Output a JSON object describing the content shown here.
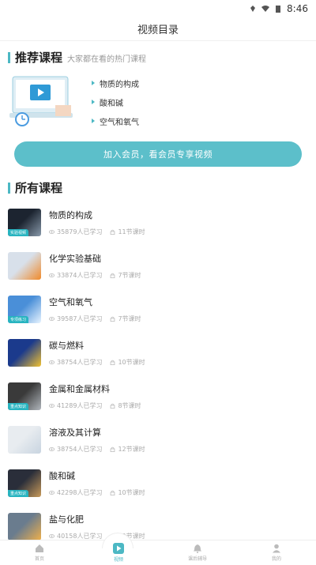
{
  "status": {
    "time": "8:46"
  },
  "page": {
    "title": "视频目录"
  },
  "recommend": {
    "title": "推荐课程",
    "subtitle": "大家都在看的热门课程",
    "items": [
      "物质的构成",
      "酸和碱",
      "空气和氧气"
    ]
  },
  "join_button": "加入会员，看会员专享视频",
  "all_courses": {
    "title": "所有课程",
    "items": [
      {
        "title": "物质的构成",
        "learners": "35879人已学习",
        "lessons": "11节课时",
        "tag": "实验视频",
        "colors": [
          "#1c2430",
          "#8899aa"
        ]
      },
      {
        "title": "化学实验基础",
        "learners": "33874人已学习",
        "lessons": "7节课时",
        "tag": "",
        "colors": [
          "#d8e0ea",
          "#f08a2a"
        ]
      },
      {
        "title": "空气和氧气",
        "learners": "39587人已学习",
        "lessons": "7节课时",
        "tag": "专项练习",
        "colors": [
          "#4a8fd8",
          "#e8f4ff"
        ]
      },
      {
        "title": "碳与燃料",
        "learners": "38754人已学习",
        "lessons": "10节课时",
        "tag": "",
        "colors": [
          "#1b3a8c",
          "#f2c230"
        ]
      },
      {
        "title": "金属和金属材料",
        "learners": "41289人已学习",
        "lessons": "8节课时",
        "tag": "重点知识",
        "colors": [
          "#3a3a3a",
          "#b0b6bc"
        ]
      },
      {
        "title": "溶液及其计算",
        "learners": "38754人已学习",
        "lessons": "12节课时",
        "tag": "",
        "colors": [
          "#e8ecf0",
          "#c8d4e0"
        ]
      },
      {
        "title": "酸和碱",
        "learners": "42298人已学习",
        "lessons": "10节课时",
        "tag": "重点知识",
        "colors": [
          "#2a2e3a",
          "#c89a5a"
        ]
      },
      {
        "title": "盐与化肥",
        "learners": "40158人已学习",
        "lessons": "12节课时",
        "tag": "",
        "colors": [
          "#6a7c8e",
          "#f0b04a"
        ]
      }
    ]
  },
  "nav": {
    "items": [
      {
        "label": "首页",
        "icon": "home-icon"
      },
      {
        "label": "视频",
        "icon": "video-icon"
      },
      {
        "label": "课后辅导",
        "icon": "bell-icon"
      },
      {
        "label": "我的",
        "icon": "person-icon"
      }
    ]
  },
  "colors": {
    "accent": "#4cb8c4",
    "button": "#5cbfca"
  }
}
